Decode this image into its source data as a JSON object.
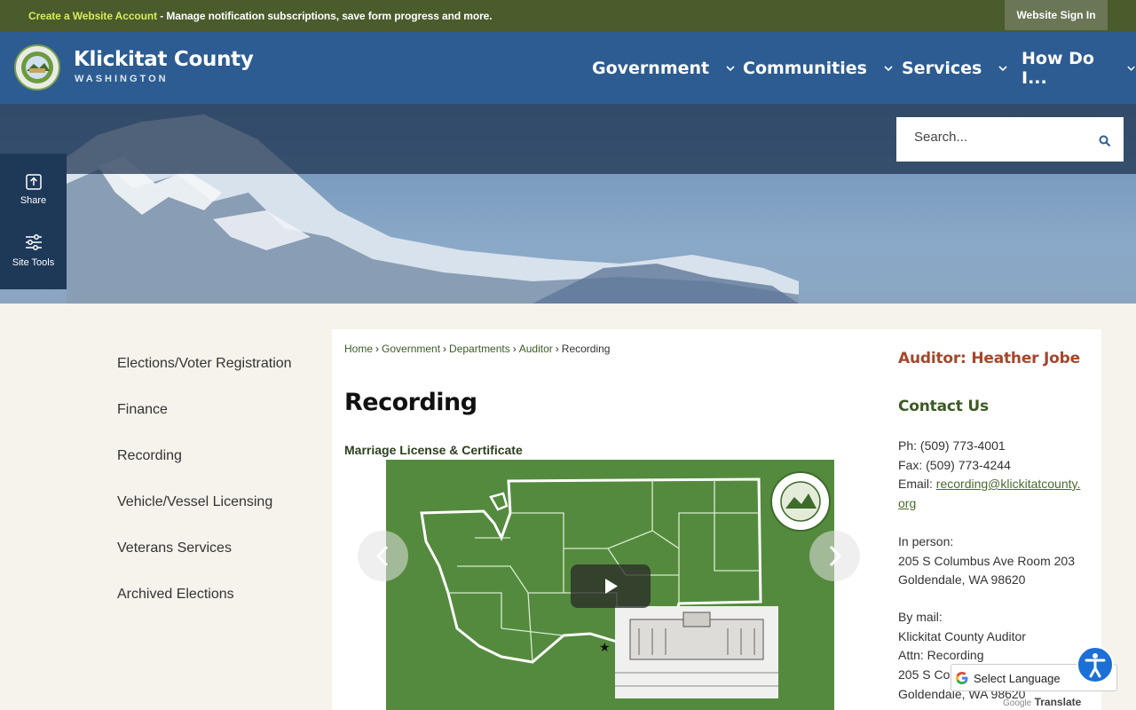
{
  "topbar": {
    "create_account_link": "Create a Website Account",
    "create_account_rest": " - Manage notification subscriptions, save form progress and more.",
    "sign_in": "Website Sign In"
  },
  "header": {
    "site_name": "Klickitat County",
    "site_sub": "WASHINGTON",
    "nav": [
      "Government",
      "Communities",
      "Services",
      "How Do I..."
    ]
  },
  "search": {
    "placeholder": "Search..."
  },
  "tools": {
    "share": "Share",
    "site_tools": "Site Tools"
  },
  "leftnav": [
    "Elections/Voter Registration",
    "Finance",
    "Recording",
    "Vehicle/Vessel Licensing",
    "Veterans Services",
    "Archived Elections"
  ],
  "breadcrumb": [
    "Home",
    "Government",
    "Departments",
    "Auditor",
    "Recording"
  ],
  "page_title": "Recording",
  "subhead": "Marriage License & Certificate",
  "sidebar": {
    "auditor": "Auditor: Heather Jobe",
    "contact_title": "Contact Us",
    "phone": "Ph: (509) 773-4001",
    "fax": "Fax: (509) 773-4244",
    "email_label": "Email: ",
    "email_1": "recording@klickitatcounty.",
    "email_2": "org",
    "in_person": "In person:",
    "address_1": "205 S Columbus Ave Room 203",
    "address_2": "Goldendale, WA 98620",
    "by_mail": "By mail:",
    "mail_1": "Klickitat County Auditor",
    "mail_2": "Attn: Recording",
    "mail_3": "205 S Co",
    "mail_4": "Goldendale, WA 98620"
  },
  "translate": {
    "label": "Select Language",
    "powered": "Google",
    "translate": "Translate"
  },
  "colors": {
    "header": "#2c5c91",
    "topbar": "#4a5b2c",
    "accent_green": "#548a3d",
    "auditor_red": "#a4472c"
  }
}
